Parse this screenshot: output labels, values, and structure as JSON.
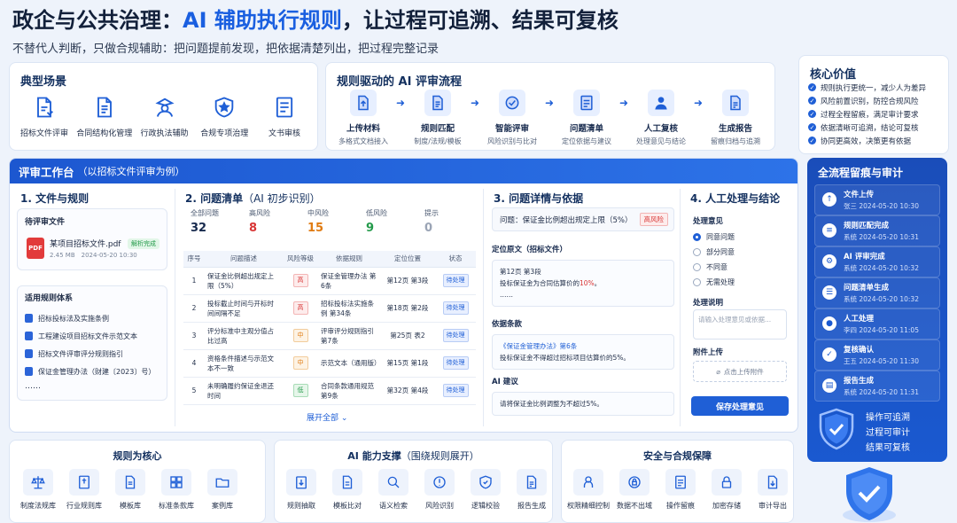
{
  "header": {
    "title_prefix": "政企与公共治理：",
    "title_highlight": "AI 辅助执行规则",
    "title_suffix": "，让过程可追溯、结果可复核",
    "subtitle": "不替代人判断，只做合规辅助：把问题提前发现，把依据清楚列出，把过程完整记录"
  },
  "scenarios": {
    "title": "典型场景",
    "items": [
      {
        "label": "招标文件评审",
        "icon": "document-check-icon"
      },
      {
        "label": "合同结构化管理",
        "icon": "document-list-icon"
      },
      {
        "label": "行政执法辅助",
        "icon": "officer-icon"
      },
      {
        "label": "合规专项治理",
        "icon": "shield-star-icon"
      },
      {
        "label": "文书审核",
        "icon": "document-edit-icon"
      }
    ]
  },
  "flow": {
    "title": "规则驱动的 AI 评审流程",
    "steps": [
      {
        "name": "上传材料",
        "desc": "多格式文档接入"
      },
      {
        "name": "规则匹配",
        "desc": "制度/法规/模板"
      },
      {
        "name": "智能评审",
        "desc": "风险识别与比对"
      },
      {
        "name": "问题清单",
        "desc": "定位依据与建议"
      },
      {
        "name": "人工复核",
        "desc": "处理意见与结论"
      },
      {
        "name": "生成报告",
        "desc": "留痕归档与追溯"
      }
    ]
  },
  "values": {
    "title": "核心价值",
    "items": [
      "规则执行更统一，减少人为差异",
      "风险前置识别，防控合规风险",
      "过程全程留痕，满足审计要求",
      "依据清晰可追溯，结论可复核",
      "协同更高效，决策更有依据"
    ]
  },
  "bench": {
    "title": "评审工作台",
    "subtitle": "（以招标文件评审为例）",
    "col1": {
      "title": "1. 文件与规则",
      "file_block_title": "待评审文件",
      "file_name": "某项目招标文件.pdf",
      "file_meta": "2.45 MB　2024-05-20 10:30",
      "file_badge": "解析完成",
      "pdf_label": "PDF",
      "rules_title": "适用规则体系",
      "rules": [
        "招标投标法及实施条例",
        "工程建设项目招标文件示范文本",
        "招标文件评审评分规则指引",
        "保证金管理办法（财建〔2023〕号）"
      ],
      "rules_more": "……"
    },
    "col2": {
      "title": "2. 问题清单",
      "title_sub": "（AI 初步识别）",
      "stats": [
        {
          "label": "全部问题",
          "value": "32",
          "color": "#16294d"
        },
        {
          "label": "高风险",
          "value": "8",
          "color": "#d83434"
        },
        {
          "label": "中风险",
          "value": "15",
          "color": "#e07b12"
        },
        {
          "label": "低风险",
          "value": "9",
          "color": "#239a4a"
        },
        {
          "label": "提示",
          "value": "0",
          "color": "#9aa4b5"
        }
      ],
      "headers": [
        "序号",
        "问题描述",
        "风险等级",
        "依据规则",
        "定位位置",
        "状态"
      ],
      "rows": [
        {
          "no": "1",
          "desc": "保证金比例超出规定上限（5%）",
          "risk": "高",
          "level": "h",
          "rule": "保证金管理办法 第6条",
          "loc": "第12页 第3段",
          "status": "待处理"
        },
        {
          "no": "2",
          "desc": "投标截止时间与开标时间间隔不足",
          "risk": "高",
          "level": "h",
          "rule": "招标投标法实施条例 第34条",
          "loc": "第18页 第2段",
          "status": "待处理"
        },
        {
          "no": "3",
          "desc": "评分标准中主观分值占比过高",
          "risk": "中",
          "level": "m",
          "rule": "评审评分规则指引 第7条",
          "loc": "第25页 表2",
          "status": "待处理"
        },
        {
          "no": "4",
          "desc": "资格条件描述与示范文本不一致",
          "risk": "中",
          "level": "m",
          "rule": "示范文本（通用版）",
          "loc": "第15页 第1段",
          "status": "待处理"
        },
        {
          "no": "5",
          "desc": "未明确履约保证金退还时间",
          "risk": "低",
          "level": "l",
          "rule": "合同条款通用规范 第9条",
          "loc": "第32页 第4段",
          "status": "待处理"
        }
      ],
      "expand": "展开全部 ⌄"
    },
    "col3": {
      "title": "3. 问题详情与依据",
      "question": "问题：保证金比例超出规定上限（5%）",
      "question_badge": "高风险",
      "orig_title": "定位原文（招标文件）",
      "orig_loc": "第12页 第3段",
      "orig_text_a": "投标保证金为合同估算价的",
      "orig_text_red": "10%",
      "orig_text_b": "。",
      "orig_more": "……",
      "basis_title": "依据条款",
      "basis_name": "《保证金管理办法》第6条",
      "basis_text": "投标保证金不得超过招标项目估算价的5%。",
      "ai_title": "AI 建议",
      "ai_text": "请将保证金比例调整为不超过5%。"
    },
    "col4": {
      "title": "4. 人工处理与结论",
      "opinion_label": "处理意见",
      "options": [
        "同意问题",
        "部分同意",
        "不同意",
        "无需处理"
      ],
      "desc_label": "处理说明",
      "desc_placeholder": "请输入处理意见或依据...",
      "attach_label": "附件上传",
      "upload_text": "点击上传附件",
      "save_label": "保存处理意见"
    }
  },
  "audit": {
    "title": "全流程留痕与审计",
    "items": [
      {
        "name": "文件上传",
        "time": "张三 2024-05-20 10:30"
      },
      {
        "name": "规则匹配完成",
        "time": "系统 2024-05-20 10:31"
      },
      {
        "name": "AI 评审完成",
        "time": "系统 2024-05-20 10:32"
      },
      {
        "name": "问题清单生成",
        "time": "系统 2024-05-20 10:32"
      },
      {
        "name": "人工处理",
        "time": "李四 2024-05-20 11:05"
      },
      {
        "name": "复核确认",
        "time": "王五 2024-05-20 11:30"
      },
      {
        "name": "报告生成",
        "time": "系统 2024-05-20 11:31"
      }
    ],
    "slogans": [
      "操作可追溯",
      "过程可审计",
      "结果可复核"
    ]
  },
  "bottom": {
    "rules": {
      "title": "规则为核心",
      "items": [
        "制度法规库",
        "行业规则库",
        "模板库",
        "标准条款库",
        "案例库"
      ]
    },
    "ai": {
      "title": "AI 能力支撑",
      "title_sub": "（围绕规则展开）",
      "items": [
        "规则抽取",
        "模板比对",
        "语义检索",
        "风险识别",
        "逻辑校验",
        "报告生成"
      ]
    },
    "security": {
      "title": "安全与合规保障",
      "items": [
        "权限精细控制",
        "数据不出域",
        "操作留痕",
        "加密存储",
        "审计导出"
      ]
    }
  },
  "colors": {
    "accent": "#1f5fd6",
    "high": "#d83434",
    "medium": "#e07b12",
    "low": "#239a4a",
    "audit_bg": "#1a4db9"
  }
}
